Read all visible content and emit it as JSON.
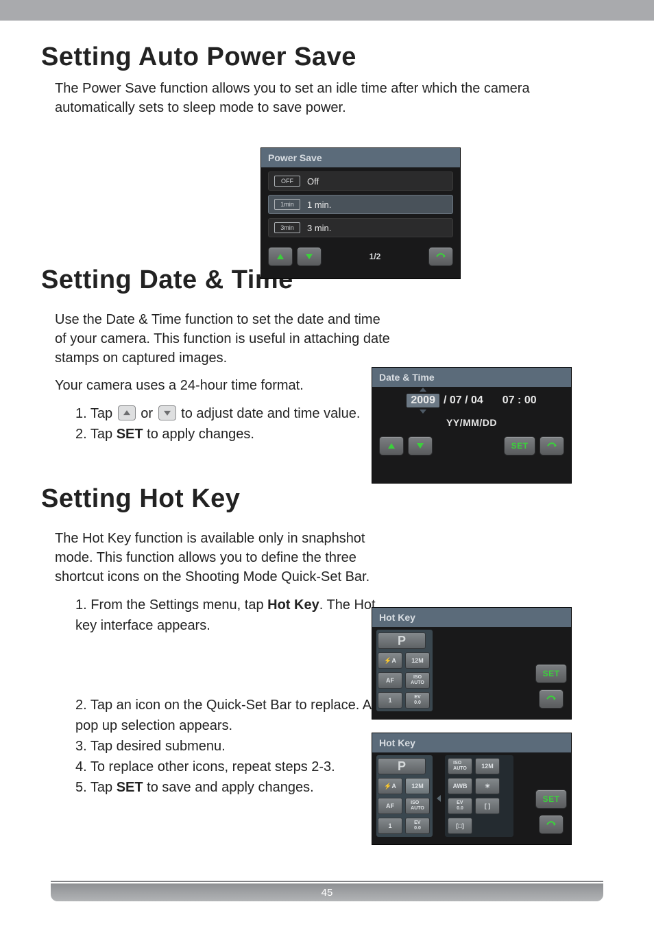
{
  "page_number": "45",
  "h1_autopower": "Setting Auto Power Save",
  "p_autopower": "The Power Save function allows you to set an idle time after which the camera automatically sets to sleep mode to save power.",
  "h1_datetime": "Setting Date & Time",
  "p_datetime_1": "Use the Date & Time function to set the date and time of your camera. This function is useful in attaching date stamps on captured images.",
  "p_datetime_2": "Your camera uses a 24-hour time format.",
  "dt_step_1_a": "1. Tap ",
  "dt_step_1_b": " or ",
  "dt_step_1_c": " to adjust date and time value.",
  "dt_step_2_a": "2. Tap ",
  "dt_step_2_set": "SET",
  "dt_step_2_b": " to apply changes.",
  "h1_hotkey": "Setting Hot Key",
  "p_hotkey": "The Hot Key function is available only in snaphshot mode. This function allows you to define the three shortcut icons on the Shooting Mode Quick-Set Bar.",
  "hk_step_1_a": "1. From the Settings menu, tap ",
  "hk_step_1_hot": "Hot Key",
  "hk_step_1_b": ". The Hot key interface appears.",
  "hk_step_2": "2. Tap an icon on the Quick-Set Bar to replace. A pop up selection appears.",
  "hk_step_3": "3. Tap desired submenu.",
  "hk_step_4": "4. To replace other icons, repeat steps 2-3.",
  "hk_step_5_a": "5. Tap ",
  "hk_step_5_set": "SET",
  "hk_step_5_b": " to save and apply changes.",
  "camera": {
    "powersave": {
      "title": "Power Save",
      "items": [
        {
          "badge": "OFF",
          "label": "Off"
        },
        {
          "badge": "1min",
          "label": "1 min."
        },
        {
          "badge": "3min",
          "label": "3 min."
        }
      ],
      "page": "1/2"
    },
    "datetime": {
      "title": "Date & Time",
      "year": "2009",
      "rest": " / 07 / 04",
      "time": "07 : 00",
      "format": "YY/MM/DD",
      "set": "SET"
    },
    "hotkey": {
      "title": "Hot Key",
      "set": "SET",
      "left": {
        "p": "P",
        "flash": "⚡A",
        "res": "12M",
        "af": "AF",
        "iso": "ISO\nAUTO",
        "one": "1",
        "ev": "EV\n0.0"
      },
      "popup": {
        "iso": "ISO\nAUTO",
        "res": "12M",
        "awb": "AWB",
        "wb_ico": "☀",
        "ev": "EV\n0.0",
        "mtr": "[ ]",
        "af_area": "[□]"
      }
    }
  }
}
